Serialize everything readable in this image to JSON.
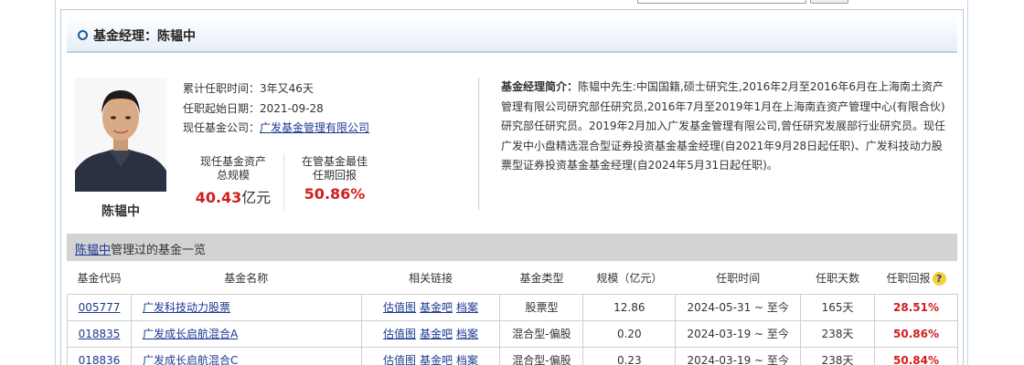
{
  "header": {
    "title": "基金经理：陈韫中"
  },
  "manager": {
    "name": "陈韫中",
    "tenure_label": "累计任职时间：",
    "tenure_value": "3年又46天",
    "start_label": "任职起始日期：",
    "start_value": "2021-09-28",
    "company_label": "现任基金公司：",
    "company_value": "广发基金管理有限公司"
  },
  "stats": {
    "assets_label_line1": "现任基金资产",
    "assets_label_line2": "总规模",
    "assets_value": "40.43",
    "assets_unit": "亿元",
    "best_label_line1": "在管基金最佳",
    "best_label_line2": "任期回报",
    "best_value": "50.86%"
  },
  "intro": {
    "label": "基金经理简介：",
    "text": "陈韫中先生:中国国籍,硕士研究生,2016年2月至2016年6月在上海南土资产管理有限公司研究部任研究员,2016年7月至2019年1月在上海南垚资产管理中心(有限合伙)研究部任研究员。2019年2月加入广发基金管理有限公司,曾任研究发展部行业研究员。现任广发中小盘精选混合型证券投资基金基金经理(自2021年9月28日起任职)、广发科技动力股票型证券投资基金基金经理(自2024年5月31日起任职)。"
  },
  "fund_list": {
    "title_link": "陈韫中",
    "title_suffix": "管理过的基金一览",
    "columns": [
      "基金代码",
      "基金名称",
      "相关链接",
      "基金类型",
      "规模（亿元）",
      "任职时间",
      "任职天数",
      "任职回报"
    ],
    "link_labels": [
      "估值图",
      "基金吧",
      "档案"
    ],
    "rows": [
      {
        "code": "005777",
        "name": "广发科技动力股票",
        "type": "股票型",
        "size": "12.86",
        "period": "2024-05-31 ~ 至今",
        "days": "165天",
        "return": "28.51%"
      },
      {
        "code": "018835",
        "name": "广发成长启航混合A",
        "type": "混合型-偏股",
        "size": "0.20",
        "period": "2024-03-19 ~ 至今",
        "days": "238天",
        "return": "50.86%"
      },
      {
        "code": "018836",
        "name": "广发成长启航混合C",
        "type": "混合型-偏股",
        "size": "0.23",
        "period": "2024-03-19 ~ 至今",
        "days": "238天",
        "return": "50.84%"
      }
    ]
  },
  "colors": {
    "accent_blue": "#1d5a9b",
    "link": "#1b3a93",
    "return_red": "#d21d1d"
  },
  "icons": {
    "help": "question-icon"
  }
}
